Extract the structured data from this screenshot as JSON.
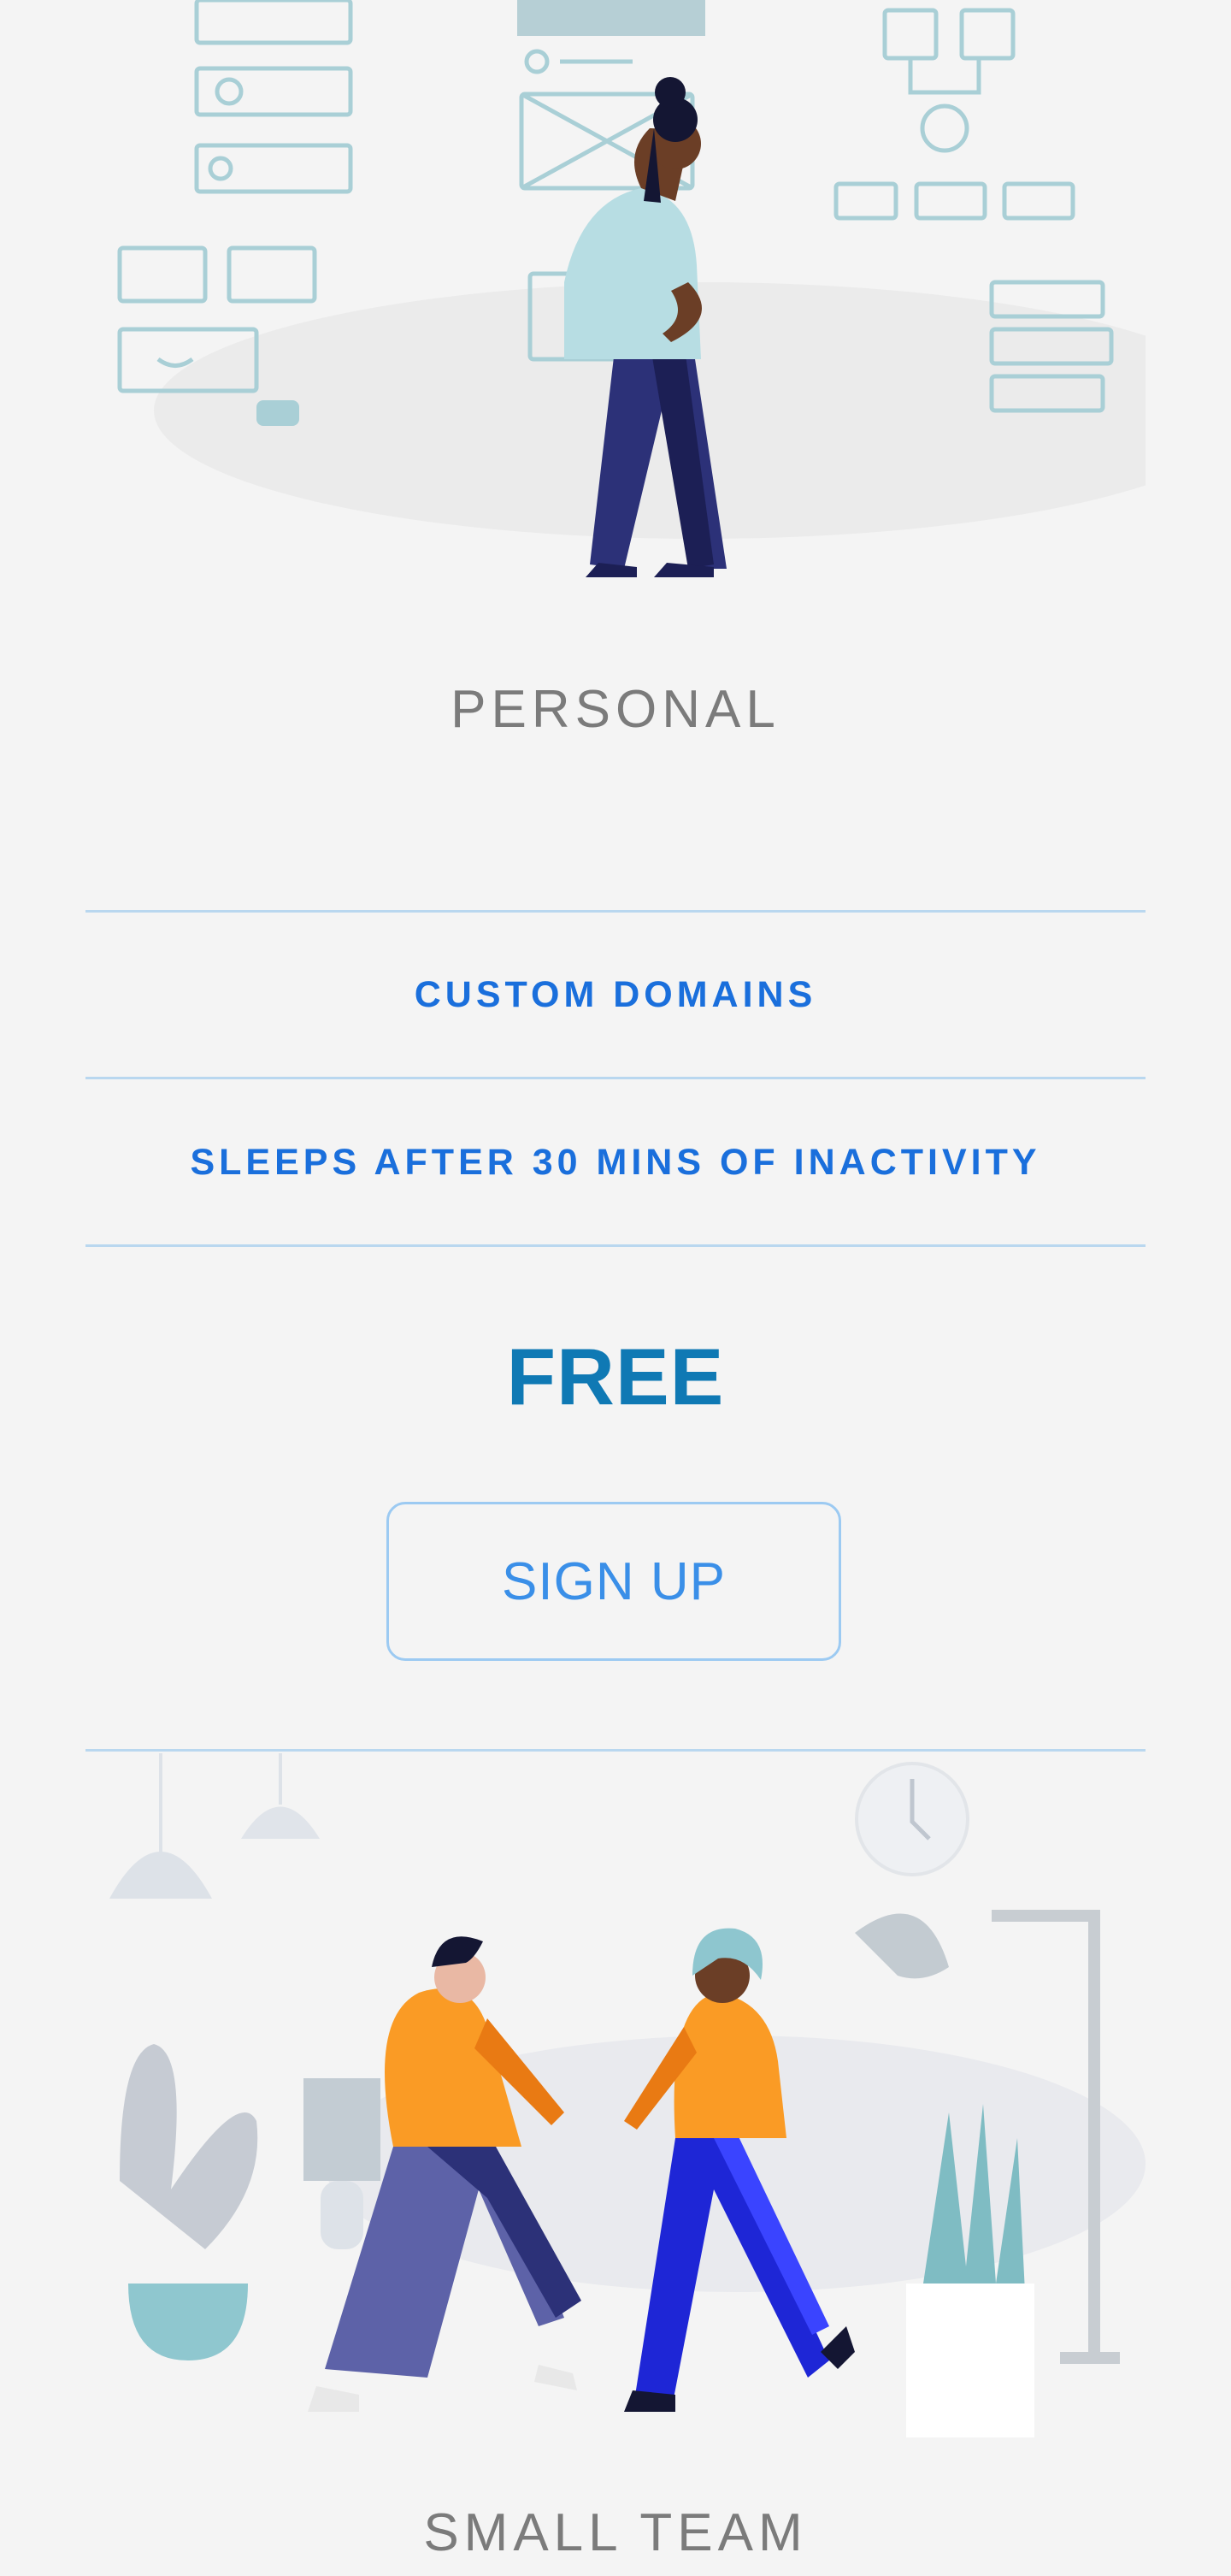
{
  "plans": [
    {
      "name": "PERSONAL",
      "features": [
        "CUSTOM DOMAINS",
        "SLEEPS AFTER 30 MINS OF INACTIVITY"
      ],
      "price": "FREE",
      "cta": "SIGN UP"
    },
    {
      "name": "SMALL TEAM"
    }
  ],
  "colors": {
    "background": "#f4f4f4",
    "plan_title": "#7b7b7b",
    "feature_text": "#1a6fdc",
    "price_text": "#0f79b4",
    "divider": "#b9d7ef",
    "button_border": "#9ccaf2",
    "button_text": "#3a8fe8"
  },
  "illustrations": [
    "woman-walking-whiteboard-illustration",
    "two-people-meeting-office-illustration"
  ]
}
